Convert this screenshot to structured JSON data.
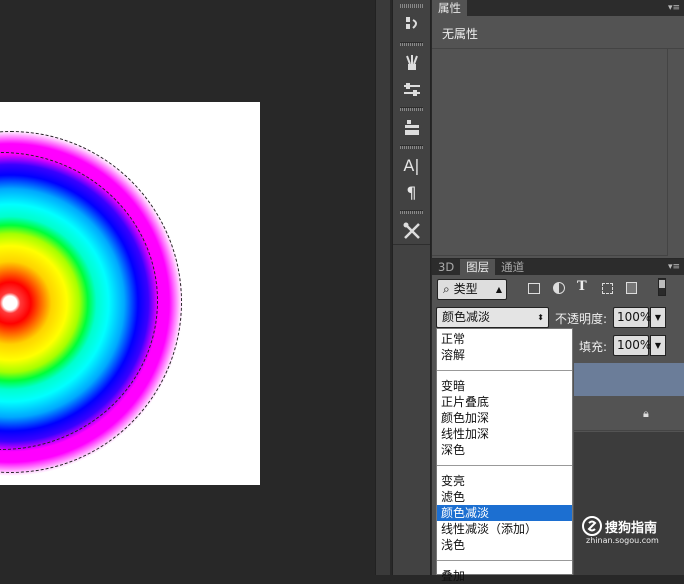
{
  "properties_panel": {
    "tab_label": "属性",
    "content_text": "无属性"
  },
  "layers_panel": {
    "tabs": [
      "3D",
      "图层",
      "通道"
    ],
    "active_tab": "图层",
    "filter_kind": "类型",
    "blend_mode": "颜色减淡",
    "opacity_label": "不透明度:",
    "opacity_value": "100%",
    "fill_label": "填充:",
    "fill_value": "100%"
  },
  "blend_menu": {
    "groups": [
      [
        "正常",
        "溶解"
      ],
      [
        "变暗",
        "正片叠底",
        "颜色加深",
        "线性加深",
        "深色"
      ],
      [
        "变亮",
        "滤色",
        "颜色减淡",
        "线性减淡（添加）",
        "浅色"
      ],
      [
        "叠加"
      ]
    ],
    "selected": "颜色减淡"
  },
  "watermark": {
    "brand": "搜狗指南",
    "url": "zhinan.sogou.com"
  },
  "colors": {
    "selection_highlight": "#1c6fd1",
    "selected_layer": "#6b7d99",
    "panel_bg": "#535353",
    "tab_bg": "#2c2c2c"
  }
}
